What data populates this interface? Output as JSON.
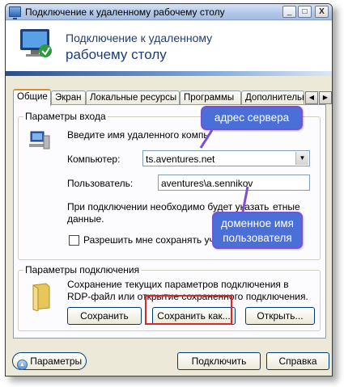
{
  "window": {
    "title": "Подключение к удаленному рабочему столу",
    "minimize": "_",
    "maximize": "□",
    "close": "X"
  },
  "header": {
    "line1": "Подключение к удаленному",
    "line2": "рабочему столу"
  },
  "tabs": [
    {
      "label": "Общие",
      "active": true
    },
    {
      "label": "Экран"
    },
    {
      "label": "Локальные ресурсы"
    },
    {
      "label": "Программы"
    },
    {
      "label": "Дополнительн"
    }
  ],
  "tab_scroll": {
    "left": "◀",
    "right": "▶"
  },
  "logon": {
    "title": "Параметры входа",
    "hint": "Введите имя удаленного компь",
    "computer_label": "Компьютер:",
    "computer_value": "ts.aventures.net",
    "user_label": "Пользователь:",
    "user_value": "aventures\\a.sennikov",
    "info_line1": "При подключении необходимо будет указать",
    "info_line2": "данные.",
    "info_tail": "етные",
    "save_checkbox_label": "Разрешить мне сохранять учет",
    "save_checkbox_checked": false
  },
  "connection": {
    "title": "Параметры подключения",
    "desc_line1": "Сохранение текущих параметров подключения в",
    "desc_line2": "RDP-файл или открытие сохраненного подключения.",
    "save_btn": "Сохранить",
    "save_as_btn": "Сохранить как...",
    "open_btn": "Открыть..."
  },
  "footer": {
    "params_btn": "Параметры",
    "connect_btn": "Подключить",
    "help_btn": "Справка"
  },
  "callouts": {
    "server": "адрес сервера",
    "user_line1": "доменное имя",
    "user_line2": "пользователя"
  },
  "colors": {
    "callout_fill": "#4a6fd6",
    "callout_border": "#7b4fd6",
    "highlight_box": "#e0252a"
  }
}
